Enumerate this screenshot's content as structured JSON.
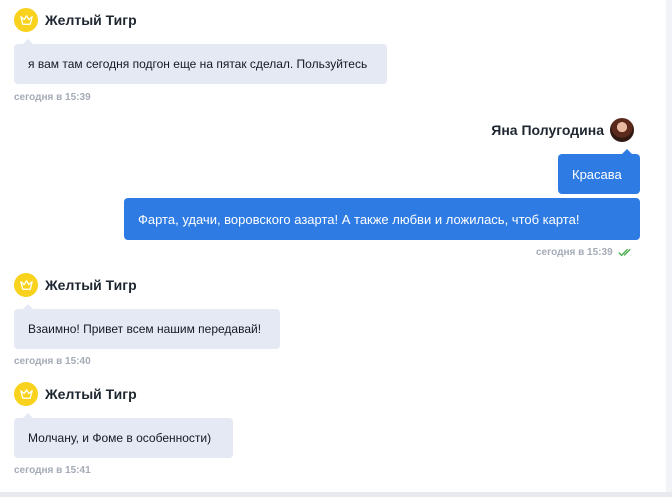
{
  "messages": [
    {
      "sender": "Желтый Тигр",
      "text": "я вам там сегодня подгон еще на пятак сделал. Пользуйтесь",
      "time": "сегодня в 15:39"
    },
    {
      "sender": "Яна Полугодина",
      "texts": [
        "Красава",
        "Фарта, удачи, воровского азарта! А также любви и ложилась, чтоб карта!"
      ],
      "time": "сегодня в 15:39"
    },
    {
      "sender": "Желтый Тигр",
      "text": "Взаимно! Привет всем нашим передавай!",
      "time": "сегодня в 15:40"
    },
    {
      "sender": "Желтый Тигр",
      "text": "Молчану, и Фоме в особенности)",
      "time": "сегодня в 15:41"
    }
  ],
  "colors": {
    "incoming_bubble": "#e4e9f3",
    "outgoing_bubble": "#2e7be4",
    "avatar_yellow": "#f8d21c",
    "read_check": "#4caf50"
  }
}
